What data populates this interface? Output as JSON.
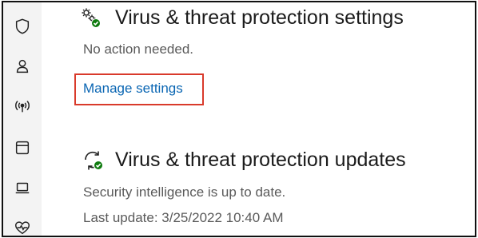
{
  "sidebar": {
    "items": [
      {
        "icon": "shield-icon"
      },
      {
        "icon": "account-icon"
      },
      {
        "icon": "network-icon"
      },
      {
        "icon": "app-browser-icon"
      },
      {
        "icon": "device-security-icon"
      },
      {
        "icon": "device-health-icon"
      }
    ]
  },
  "settings_section": {
    "icon": "settings-gear-check-icon",
    "title": "Virus & threat protection settings",
    "status": "No action needed.",
    "link": "Manage settings"
  },
  "updates_section": {
    "icon": "update-refresh-check-icon",
    "title": "Virus & threat protection updates",
    "status": "Security intelligence is up to date.",
    "last_update": "Last update: 3/25/2022 10:40 AM"
  },
  "colors": {
    "link": "#0a66b3",
    "highlight_box": "#d93a2b",
    "status_ok": "#0f7b0f"
  }
}
